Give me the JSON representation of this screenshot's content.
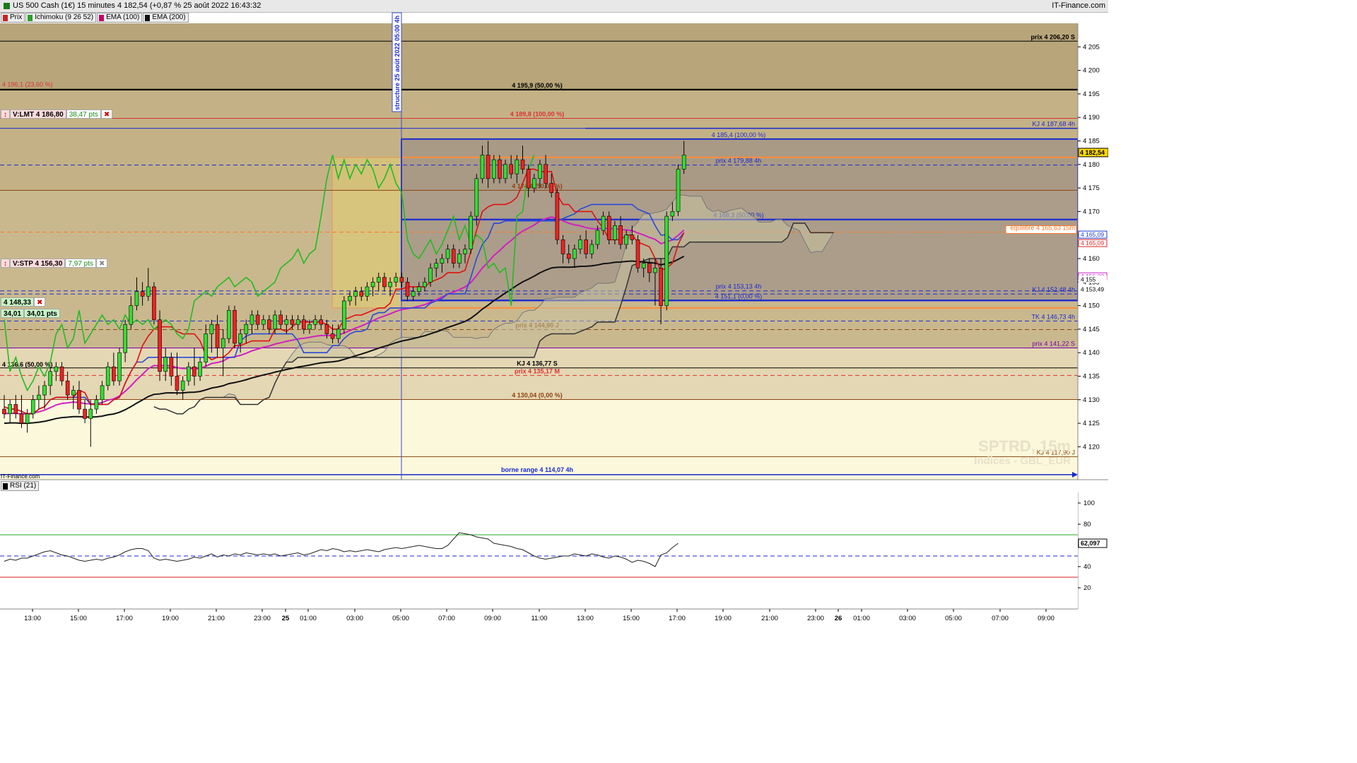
{
  "header": {
    "title": "US 500 Cash (1€) 15 minutes 4 182,54 (+0,87 % 25 août 2022 16:43:32",
    "brand": "IT-Finance.com"
  },
  "legend": [
    {
      "label": "Prix",
      "color": "#cc2222"
    },
    {
      "label": "Ichimoku (9 26 52)",
      "color": "#2aa02a"
    },
    {
      "label": "EMA (100)",
      "color": "#cc0066"
    },
    {
      "label": "EMA (200)",
      "color": "#111111"
    }
  ],
  "widgets": {
    "lmt": {
      "label": "V:LMT",
      "price": "4 186,80",
      "pts": "38,47 pts",
      "close": "✖"
    },
    "stp": {
      "label": "V:STP",
      "price": "4 156,30",
      "pts": "7,97 pts",
      "close": "✖"
    },
    "entry": {
      "price": "4 148,33",
      "close": "✖",
      "a": "34,01",
      "b": "34,01 pts"
    }
  },
  "watermark": {
    "line1": "SPTRD, 15m",
    "line2": "Indices - GBL_EUR"
  },
  "corner_credit": "IT-Finance.com",
  "vertical_note": "structure 25 août 2022 05:00 4h",
  "rsi": {
    "label": "RSI (21)",
    "value": "62,097",
    "ticks": [
      "100",
      "80",
      "60",
      "40",
      "20"
    ]
  },
  "colors": {
    "bull": "#33dd33",
    "bear": "#ee2222",
    "tenkan": "#e01010",
    "kijun": "#2a4ad8",
    "chikou": "#22bb22",
    "ema100": "#d020c0",
    "ema200": "#111111",
    "cloud": "#c8c2a0"
  },
  "chart_data": {
    "type": "candlestick",
    "title": "US 500 Cash (1€) 15 minutes",
    "ylim": [
      4113,
      4210
    ],
    "y_ticks": [
      4120,
      4125,
      4130,
      4135,
      4140,
      4145,
      4150,
      4155,
      4160,
      4165,
      4170,
      4175,
      4180,
      4185,
      4190,
      4195,
      4200,
      4205
    ],
    "y_tick_labels": [
      "4 120",
      "4 125",
      "4 130",
      "4 135",
      "4 140",
      "4 145",
      "4 150",
      "4 155",
      "4 160",
      "4 165",
      "4 170",
      "4 175",
      "4 180",
      "4 185",
      "4 190",
      "4 195",
      "4 200",
      "4 205"
    ],
    "x_tick_labels": [
      "13:00",
      "15:00",
      "17:00",
      "19:00",
      "21:00",
      "23:00",
      "25",
      "01:00",
      "03:00",
      "05:00",
      "07:00",
      "09:00",
      "11:00",
      "13:00",
      "15:00",
      "17:00",
      "19:00",
      "21:00",
      "23:00",
      "26",
      "01:00",
      "03:00",
      "05:00",
      "07:00",
      "09:00"
    ],
    "last_price": {
      "value": 4182.54,
      "label": "4 182,54"
    },
    "right_markers": [
      {
        "value": 4165.09,
        "label": "4 165,09",
        "color": "#1a3ad0"
      },
      {
        "value": 4165.09,
        "label": "4 165,09",
        "color": "#dd2222"
      },
      {
        "value": 4156.22,
        "label": "4 156,22",
        "color": "#cc22cc"
      },
      {
        "value": 4155,
        "label": "4 155",
        "color": "#000000"
      },
      {
        "value": 4153.49,
        "label": "4 153,49",
        "color": "#000000"
      }
    ],
    "levels": [
      {
        "value": 4206.2,
        "label": "prix 4 206,20 S",
        "color": "#000000",
        "style": "solid",
        "align": "right"
      },
      {
        "value": 4196.1,
        "label": "4 196,1 (23,60 %)",
        "color": "#dd3333",
        "style": "none",
        "align": "left"
      },
      {
        "value": 4195.9,
        "label": "4 195,9 (50,00 %)",
        "color": "#000000",
        "style": "thick",
        "align": "center"
      },
      {
        "value": 4189.8,
        "label": "4 189,8 (100,00 %)",
        "color": "#dd3333",
        "style": "solid",
        "align": "center"
      },
      {
        "value": 4187.68,
        "label": "KJ 4 187,68 4h",
        "color": "#1a2ad0",
        "style": "solid",
        "align": "right"
      },
      {
        "value": 4185.4,
        "label": "4 185,4 (100,00 %)",
        "color": "#1a2ad0",
        "style": "none",
        "align": "mid"
      },
      {
        "value": 4179.88,
        "label": "prix 4 179,88 4h",
        "color": "#1a2ad0",
        "style": "dashed",
        "align": "mid"
      },
      {
        "value": 4174.5,
        "label": "4 174,4 (50,00 %)",
        "color": "#8b4513",
        "style": "solid",
        "align": "center"
      },
      {
        "value": 4168.3,
        "label": "4 168,3 (50,00 %)",
        "color": "#1a2ad0",
        "style": "thick",
        "align": "mid"
      },
      {
        "value": 4165.63,
        "label": "equilibre 4 165,63 15m",
        "color": "#ff7722",
        "style": "dashed",
        "align": "right"
      },
      {
        "value": 4153.13,
        "label": "prix 4 153,13 4h",
        "color": "#1a2ad0",
        "style": "dashed",
        "align": "mid"
      },
      {
        "value": 4152.48,
        "label": "KJ 4 152,48 4h",
        "color": "#1a2ad0",
        "style": "dashed",
        "align": "right"
      },
      {
        "value": 4151.1,
        "label": "4 151,1 (0,00 %)",
        "color": "#1a2ad0",
        "style": "thick",
        "align": "mid"
      },
      {
        "value": 4146.73,
        "label": "TK 4 146,73 4h",
        "color": "#1a2ad0",
        "style": "dashed",
        "align": "right"
      },
      {
        "value": 4144.9,
        "label": "prix 4 144,90 J",
        "color": "#8b4513",
        "style": "dashed",
        "align": "center"
      },
      {
        "value": 4141,
        "label": "prix 4 141,22 S",
        "color": "#7a00aa",
        "style": "solid",
        "align": "right"
      },
      {
        "value": 4136.77,
        "label": "KJ 4 136,77 S",
        "color": "#000000",
        "style": "solid",
        "align": "center"
      },
      {
        "value": 4136.6,
        "label": "4 136,6 (50,00 %)",
        "color": "#000000",
        "style": "none",
        "align": "left"
      },
      {
        "value": 4135.17,
        "label": "prix 4 135,17 M",
        "color": "#dd3333",
        "style": "dashed",
        "align": "center"
      },
      {
        "value": 4130.04,
        "label": "4 130,04 (0,00 %)",
        "color": "#8b4513",
        "style": "solid",
        "align": "center"
      },
      {
        "value": 4117.9,
        "label": "KJ 4 117,90 J",
        "color": "#8b4513",
        "style": "solid",
        "align": "right"
      },
      {
        "value": 4114.07,
        "label": "borne range 4 114,07 4h",
        "color": "#1a2ad0",
        "style": "arrow",
        "align": "center"
      }
    ],
    "candles": [
      [
        4128,
        4131,
        4126,
        4127
      ],
      [
        4127,
        4130,
        4125,
        4129
      ],
      [
        4129,
        4131,
        4126,
        4127
      ],
      [
        4127,
        4131,
        4124,
        4125
      ],
      [
        4125,
        4128,
        4123,
        4127
      ],
      [
        4127,
        4131,
        4126,
        4130
      ],
      [
        4130,
        4133,
        4128,
        4131
      ],
      [
        4131,
        4134,
        4128,
        4133
      ],
      [
        4133,
        4137,
        4131,
        4136
      ],
      [
        4136,
        4138,
        4134,
        4137
      ],
      [
        4137,
        4138,
        4133,
        4134
      ],
      [
        4134,
        4136,
        4130,
        4131
      ],
      [
        4131,
        4133,
        4128,
        4132
      ],
      [
        4132,
        4134,
        4127,
        4128
      ],
      [
        4128,
        4130,
        4125,
        4126
      ],
      [
        4126,
        4130,
        4120,
        4128
      ],
      [
        4128,
        4131,
        4127,
        4130
      ],
      [
        4130,
        4134,
        4129,
        4133
      ],
      [
        4133,
        4138,
        4132,
        4137
      ],
      [
        4137,
        4140,
        4133,
        4134
      ],
      [
        4134,
        4141,
        4133,
        4140
      ],
      [
        4140,
        4147,
        4138,
        4146
      ],
      [
        4146,
        4152,
        4145,
        4150
      ],
      [
        4150,
        4156,
        4149,
        4153
      ],
      [
        4153,
        4155,
        4150,
        4152
      ],
      [
        4152,
        4158,
        4151,
        4154
      ],
      [
        4154,
        4155,
        4146,
        4147
      ],
      [
        4147,
        4149,
        4134,
        4136
      ],
      [
        4136,
        4141,
        4134,
        4139
      ],
      [
        4139,
        4140,
        4133,
        4135
      ],
      [
        4135,
        4140,
        4131,
        4132
      ],
      [
        4132,
        4135,
        4130,
        4134
      ],
      [
        4134,
        4138,
        4133,
        4137
      ],
      [
        4137,
        4141,
        4133,
        4135
      ],
      [
        4135,
        4139,
        4134,
        4138
      ],
      [
        4138,
        4146,
        4137,
        4144
      ],
      [
        4144,
        4147,
        4140,
        4146
      ],
      [
        4146,
        4148,
        4139,
        4141
      ],
      [
        4141,
        4145,
        4135,
        4143
      ],
      [
        4143,
        4150,
        4142,
        4149
      ],
      [
        4149,
        4150,
        4141,
        4142
      ],
      [
        4142,
        4145,
        4140,
        4144
      ],
      [
        4144,
        4147,
        4142,
        4146
      ],
      [
        4146,
        4149,
        4144,
        4148
      ],
      [
        4148,
        4149,
        4145,
        4146
      ],
      [
        4146,
        4148,
        4145,
        4147
      ],
      [
        4147,
        4148,
        4144,
        4145
      ],
      [
        4145,
        4149,
        4144,
        4148
      ],
      [
        4148,
        4149,
        4145,
        4146
      ],
      [
        4146,
        4148,
        4144,
        4147
      ],
      [
        4147,
        4148,
        4145,
        4146
      ],
      [
        4146,
        4148,
        4145,
        4147
      ],
      [
        4147,
        4148,
        4144,
        4145
      ],
      [
        4145,
        4147,
        4144,
        4146
      ],
      [
        4146,
        4148,
        4145,
        4147
      ],
      [
        4147,
        4148,
        4145,
        4146
      ],
      [
        4146,
        4147,
        4143,
        4144
      ],
      [
        4144,
        4146,
        4142,
        4143
      ],
      [
        4143,
        4146,
        4142,
        4145
      ],
      [
        4145,
        4152,
        4144,
        4151
      ],
      [
        4151,
        4153,
        4150,
        4152
      ],
      [
        4152,
        4154,
        4150,
        4153
      ],
      [
        4153,
        4154,
        4151,
        4152
      ],
      [
        4152,
        4155,
        4151,
        4154
      ],
      [
        4154,
        4156,
        4152,
        4155
      ],
      [
        4155,
        4157,
        4153,
        4156
      ],
      [
        4156,
        4157,
        4153,
        4154
      ],
      [
        4154,
        4156,
        4152,
        4155
      ],
      [
        4155,
        4157,
        4154,
        4156
      ],
      [
        4156,
        4157,
        4154,
        4155
      ],
      [
        4155,
        4156,
        4151,
        4152
      ],
      [
        4152,
        4154,
        4151,
        4153
      ],
      [
        4153,
        4155,
        4152,
        4154
      ],
      [
        4154,
        4156,
        4153,
        4155
      ],
      [
        4155,
        4159,
        4154,
        4158
      ],
      [
        4158,
        4160,
        4156,
        4159
      ],
      [
        4159,
        4161,
        4157,
        4160
      ],
      [
        4160,
        4163,
        4159,
        4162
      ],
      [
        4162,
        4163,
        4158,
        4159
      ],
      [
        4159,
        4162,
        4158,
        4161
      ],
      [
        4161,
        4163,
        4159,
        4162
      ],
      [
        4162,
        4170,
        4161,
        4169
      ],
      [
        4169,
        4178,
        4167,
        4177
      ],
      [
        4177,
        4184,
        4176,
        4182
      ],
      [
        4182,
        4185,
        4175,
        4177
      ],
      [
        4177,
        4182,
        4176,
        4181
      ],
      [
        4181,
        4182,
        4176,
        4177
      ],
      [
        4177,
        4181,
        4176,
        4180
      ],
      [
        4180,
        4182,
        4177,
        4178
      ],
      [
        4178,
        4182,
        4176,
        4181
      ],
      [
        4181,
        4184,
        4178,
        4179
      ],
      [
        4179,
        4180,
        4173,
        4175
      ],
      [
        4175,
        4178,
        4174,
        4177
      ],
      [
        4177,
        4181,
        4175,
        4180
      ],
      [
        4180,
        4182,
        4175,
        4176
      ],
      [
        4176,
        4178,
        4173,
        4174
      ],
      [
        4174,
        4175,
        4163,
        4164
      ],
      [
        4164,
        4165,
        4159,
        4161
      ],
      [
        4161,
        4163,
        4159,
        4160
      ],
      [
        4160,
        4163,
        4158,
        4162
      ],
      [
        4162,
        4165,
        4161,
        4164
      ],
      [
        4164,
        4166,
        4160,
        4161
      ],
      [
        4161,
        4164,
        4160,
        4163
      ],
      [
        4163,
        4167,
        4162,
        4166
      ],
      [
        4166,
        4170,
        4165,
        4169
      ],
      [
        4169,
        4170,
        4163,
        4164
      ],
      [
        4164,
        4168,
        4163,
        4167
      ],
      [
        4167,
        4169,
        4162,
        4163
      ],
      [
        4163,
        4166,
        4162,
        4165
      ],
      [
        4165,
        4167,
        4163,
        4164
      ],
      [
        4164,
        4165,
        4157,
        4158
      ],
      [
        4158,
        4160,
        4156,
        4159
      ],
      [
        4159,
        4160,
        4155,
        4157
      ],
      [
        4157,
        4160,
        4150,
        4158
      ],
      [
        4158,
        4160,
        4146,
        4150
      ],
      [
        4150,
        4170,
        4149,
        4169
      ],
      [
        4169,
        4172,
        4168,
        4170
      ],
      [
        4170,
        4180,
        4169,
        4179
      ],
      [
        4179,
        4185,
        4178,
        4182
      ]
    ],
    "rsi_ylim": [
      0,
      110
    ],
    "rsi_levels": [
      70,
      50,
      30
    ],
    "rsi_values": [
      45,
      47,
      46,
      48,
      48,
      50,
      52,
      54,
      55,
      53,
      51,
      50,
      48,
      46,
      45,
      46,
      47,
      46,
      48,
      49,
      51,
      54,
      56,
      57,
      57,
      55,
      48,
      46,
      47,
      46,
      45,
      46,
      47,
      49,
      48,
      50,
      52,
      49,
      51,
      50,
      52,
      51,
      53,
      52,
      51,
      52,
      51,
      52,
      50,
      51,
      52,
      53,
      51,
      52,
      54,
      56,
      55,
      57,
      56,
      54,
      55,
      54,
      55,
      56,
      55,
      54,
      56,
      57,
      58,
      57,
      58,
      59,
      60,
      59,
      58,
      57,
      57,
      60,
      66,
      72,
      71,
      70,
      68,
      67,
      66,
      62,
      61,
      60,
      59,
      57,
      56,
      53,
      50,
      48,
      47,
      48,
      49,
      50,
      50,
      52,
      51,
      50,
      52,
      51,
      49,
      48,
      50,
      49,
      47,
      44,
      46,
      45,
      43,
      40,
      51,
      53,
      58,
      62
    ]
  }
}
